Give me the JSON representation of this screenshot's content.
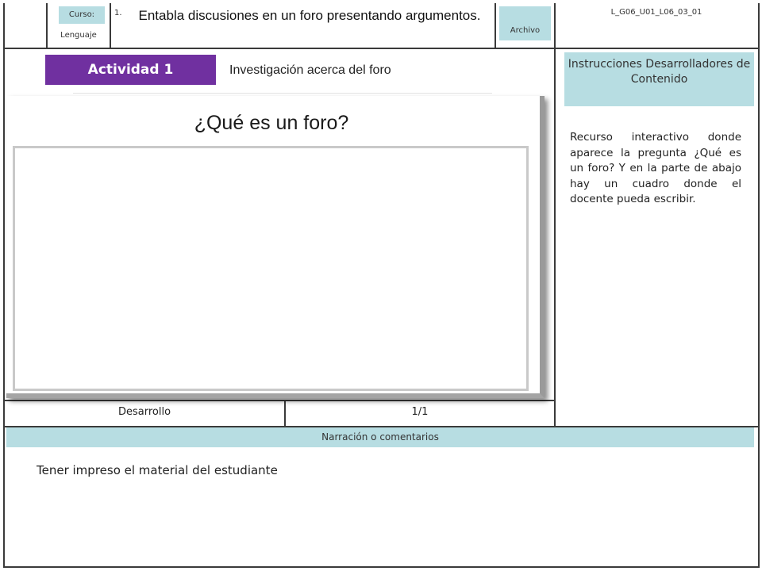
{
  "header": {
    "course_label": "Curso:",
    "course_value": "Lenguaje",
    "number": "1.",
    "title": "Entabla discusiones en un foro presentando argumentos.",
    "archive_label": "Archivo",
    "code": "L_G06_U01_L06_03_01"
  },
  "activity": {
    "badge": "Actividad 1",
    "subtitle": "Investigación acerca del foro",
    "question": "¿Qué es un foro?"
  },
  "instructions": {
    "title": "Instrucciones Desarrolladores de Contenido",
    "body": "Recurso interactivo donde aparece la pregunta ¿Qué es un foro? Y en la parte de abajo hay un cuadro donde el docente pueda escribir."
  },
  "footer_row": {
    "section": "Desarrollo",
    "page": "1/1"
  },
  "narration": {
    "title": "Narración o comentarios",
    "text": "Tener impreso el material del estudiante"
  },
  "colors": {
    "badge_purple": "#7030a0",
    "label_cyan": "#b7dde2",
    "border": "#3a3a3a"
  }
}
